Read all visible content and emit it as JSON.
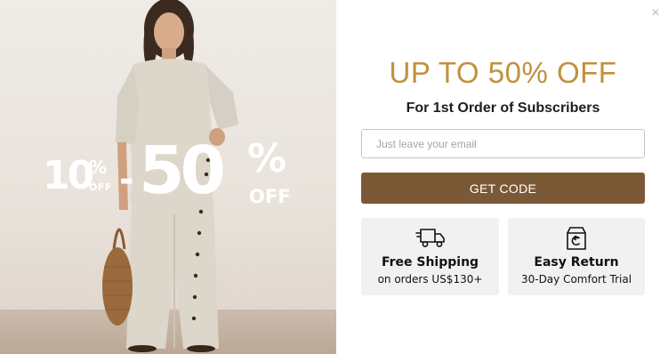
{
  "promo": {
    "discount_low": "10",
    "discount_low_percent": "%",
    "discount_low_off": "OFF",
    "discount_dash": "-",
    "discount_high": "50",
    "discount_high_percent": "%",
    "discount_high_off": "OFF"
  },
  "close": {
    "label": "×"
  },
  "headline": "UP TO 50% OFF",
  "subheadline": "For 1st Order of Subscribers",
  "email": {
    "placeholder": "Just leave your email",
    "value": ""
  },
  "cta": {
    "label": "GET CODE"
  },
  "perks": [
    {
      "icon": "delivery-truck-icon",
      "title": "Free Shipping",
      "subtitle": "on orders US$130+"
    },
    {
      "icon": "return-box-icon",
      "title": "Easy Return",
      "subtitle": "30-Day Comfort Trial"
    }
  ],
  "colors": {
    "accent_gold": "#c0913d",
    "button_brown": "#7b5937",
    "perk_bg": "#f1f1f1",
    "text_dark": "#1d1d1d"
  }
}
